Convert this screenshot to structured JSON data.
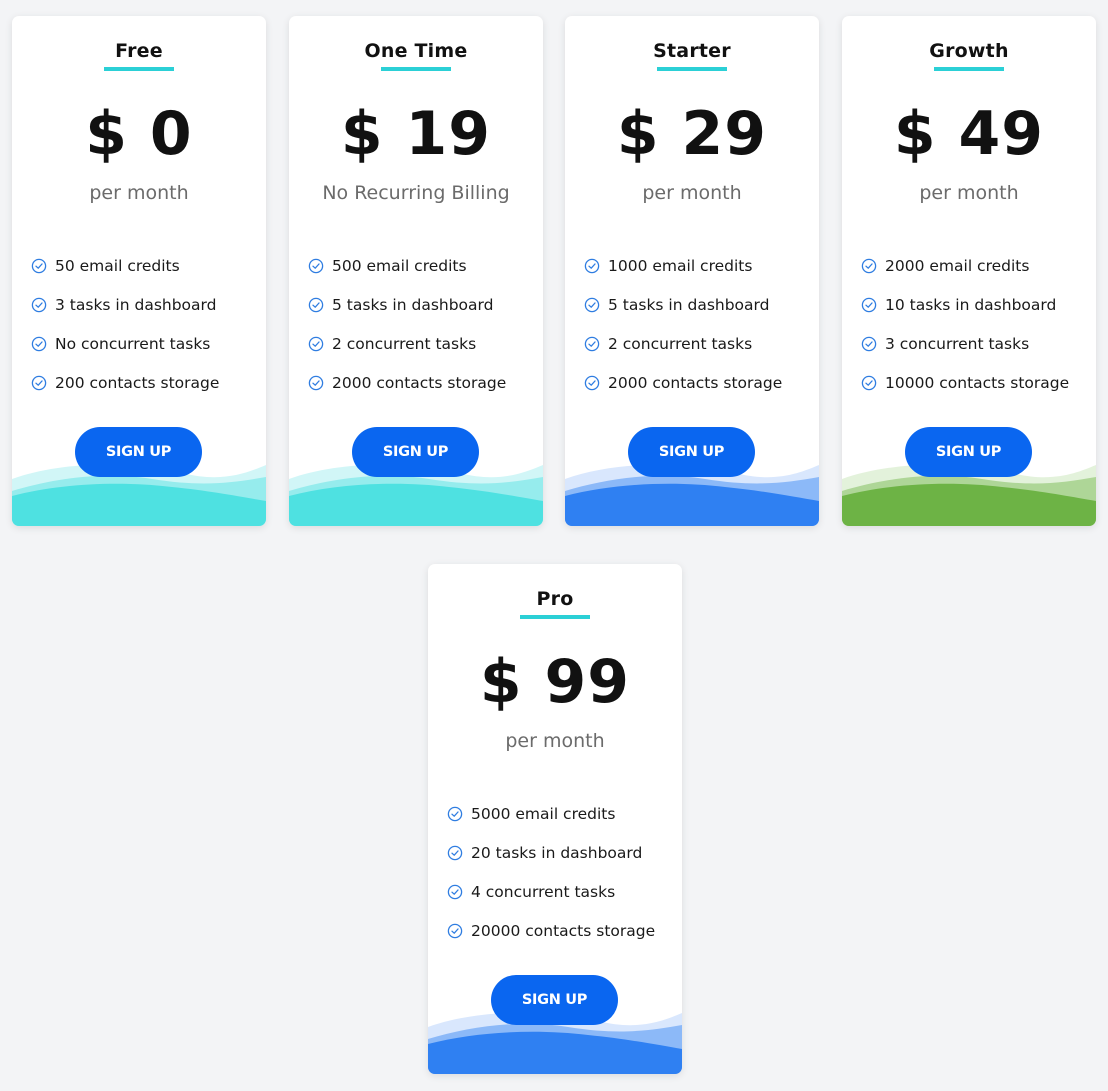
{
  "plans": [
    {
      "name": "Free",
      "price": "$ 0",
      "period": "per month",
      "features": [
        "50 email credits",
        "3 tasks in dashboard",
        "No concurrent tasks",
        "200 contacts storage"
      ],
      "cta": "SIGN UP",
      "wave_color": "#4ee1e1",
      "wave_light": "#c6f4f5"
    },
    {
      "name": "One Time",
      "price": "$ 19",
      "period": "No Recurring Billing",
      "features": [
        "500 email credits",
        "5 tasks in dashboard",
        "2 concurrent tasks",
        "2000 contacts storage"
      ],
      "cta": "SIGN UP",
      "wave_color": "#4ee1e1",
      "wave_light": "#c6f4f5"
    },
    {
      "name": "Starter",
      "price": "$ 29",
      "period": "per month",
      "features": [
        "1000 email credits",
        "5 tasks in dashboard",
        "2 concurrent tasks",
        "2000 contacts storage"
      ],
      "cta": "SIGN UP",
      "wave_color": "#2f80f2",
      "wave_light": "#cfe1fc"
    },
    {
      "name": "Growth",
      "price": "$ 49",
      "period": "per month",
      "features": [
        "2000 email credits",
        "10 tasks in dashboard",
        "3 concurrent tasks",
        "10000 contacts storage"
      ],
      "cta": "SIGN UP",
      "wave_color": "#6db345",
      "wave_light": "#dcefd2"
    },
    {
      "name": "Pro",
      "price": "$ 99",
      "period": "per month",
      "features": [
        "5000 email credits",
        "20 tasks in dashboard",
        "4 concurrent tasks",
        "20000 contacts storage"
      ],
      "cta": "SIGN UP",
      "wave_color": "#2f80f2",
      "wave_light": "#cfe1fc"
    }
  ],
  "colors": {
    "accent_underline": "#2bd0d6",
    "button": "#0a66f0",
    "check": "#2f7de1"
  }
}
